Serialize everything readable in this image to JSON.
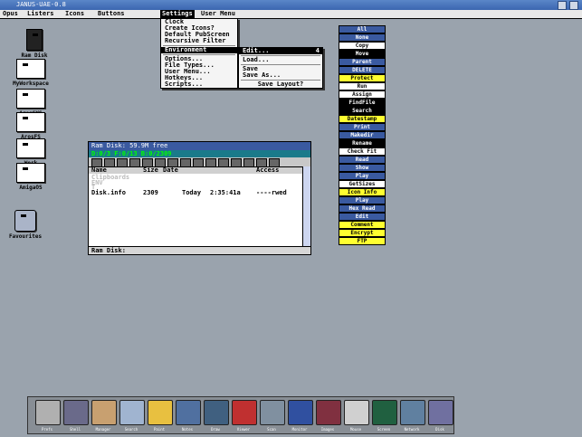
{
  "window": {
    "title": "JANUS-UAE-0.8"
  },
  "menubar": [
    "Opus",
    "Listers",
    "Icons",
    "Buttons",
    "Settings",
    "User Menu"
  ],
  "settings_menu": {
    "items": [
      "Clock",
      "Create Icons?",
      "Default PubScreen",
      "Recursive Filter",
      "Environment",
      "Options...",
      "File Types...",
      "User Menu...",
      "Hotkeys...",
      "Scripts..."
    ],
    "selected": "Environment"
  },
  "environment_submenu": {
    "items": [
      "Edit...",
      "Load...",
      "Save",
      "Save As...",
      "Save Layout?"
    ],
    "edit_shortcut": "4"
  },
  "desktop_icons": [
    {
      "label": "Ram Disk"
    },
    {
      "label": "MyWorkspace"
    },
    {
      "label": "ArosSYS"
    },
    {
      "label": "ArosFS"
    },
    {
      "label": "Work"
    },
    {
      "label": "AmigaOS"
    },
    {
      "label": "Favourites"
    }
  ],
  "button_bank": [
    {
      "label": "All",
      "color": "#3a5aa0",
      "text": "#ffffff"
    },
    {
      "label": "None",
      "color": "#3a5aa0",
      "text": "#ffffff"
    },
    {
      "label": "Copy",
      "color": "#ffffff",
      "text": "#000000"
    },
    {
      "label": "Move",
      "color": "#000000",
      "text": "#ffffff"
    },
    {
      "label": "Parent",
      "color": "#3a5aa0",
      "text": "#ffffff"
    },
    {
      "label": "DELETE",
      "color": "#3a5aa0",
      "text": "#ffffff"
    },
    {
      "label": "Protect",
      "color": "#ffff30",
      "text": "#000000"
    },
    {
      "label": "Run",
      "color": "#ffffff",
      "text": "#000000"
    },
    {
      "label": "Assign",
      "color": "#ffffff",
      "text": "#000000"
    },
    {
      "label": "FindFile",
      "color": "#000000",
      "text": "#ffffff"
    },
    {
      "label": "Search",
      "color": "#000000",
      "text": "#ffffff"
    },
    {
      "label": "Datestamp",
      "color": "#ffff30",
      "text": "#000000"
    },
    {
      "label": "Print",
      "color": "#3a5aa0",
      "text": "#ffffff"
    },
    {
      "label": "Makedir",
      "color": "#3a5aa0",
      "text": "#ffffff"
    },
    {
      "label": "Rename",
      "color": "#000000",
      "text": "#ffffff"
    },
    {
      "label": "Check Fit",
      "color": "#ffffff",
      "text": "#000000"
    },
    {
      "label": "Read",
      "color": "#3a5aa0",
      "text": "#ffffff"
    },
    {
      "label": "Show",
      "color": "#3a5aa0",
      "text": "#ffffff"
    },
    {
      "label": "Play",
      "color": "#3a5aa0",
      "text": "#ffffff"
    },
    {
      "label": "GetSizes",
      "color": "#ffffff",
      "text": "#000000"
    },
    {
      "label": "Icon Info",
      "color": "#ffff30",
      "text": "#000000"
    },
    {
      "label": "Play",
      "color": "#3a5aa0",
      "text": "#ffffff"
    },
    {
      "label": "Hex Read",
      "color": "#3a5aa0",
      "text": "#ffffff"
    },
    {
      "label": "Edit",
      "color": "#3a5aa0",
      "text": "#ffffff"
    },
    {
      "label": "Comment",
      "color": "#ffff30",
      "text": "#000000"
    },
    {
      "label": "Encrypt",
      "color": "#ffff30",
      "text": "#000000"
    },
    {
      "label": "FTP",
      "color": "#ffff30",
      "text": "#000000"
    }
  ],
  "lister": {
    "title": "Ram Disk:  59.9M free",
    "info": "D:0/3 F:0/13 B:0/2309",
    "columns": [
      "Name",
      "Size",
      "Date",
      "Access"
    ],
    "ghost_rows": [
      [
        "Clipboards",
        "",
        "",
        ""
      ],
      [
        "ENV",
        "",
        "",
        ""
      ],
      [
        "T",
        "",
        "",
        ""
      ]
    ],
    "rows": [
      [
        "Disk.info",
        "2309",
        "Today",
        "2:35:41a",
        "----rwed"
      ]
    ],
    "path": "Ram Disk:"
  },
  "dock_items": [
    "Prefs",
    "Shell",
    "Manager",
    "Search",
    "Paint",
    "Notes",
    "Draw",
    "Viewer",
    "Scan",
    "Monitor",
    "Images",
    "Mouse",
    "Screen",
    "Network",
    "Disk"
  ]
}
